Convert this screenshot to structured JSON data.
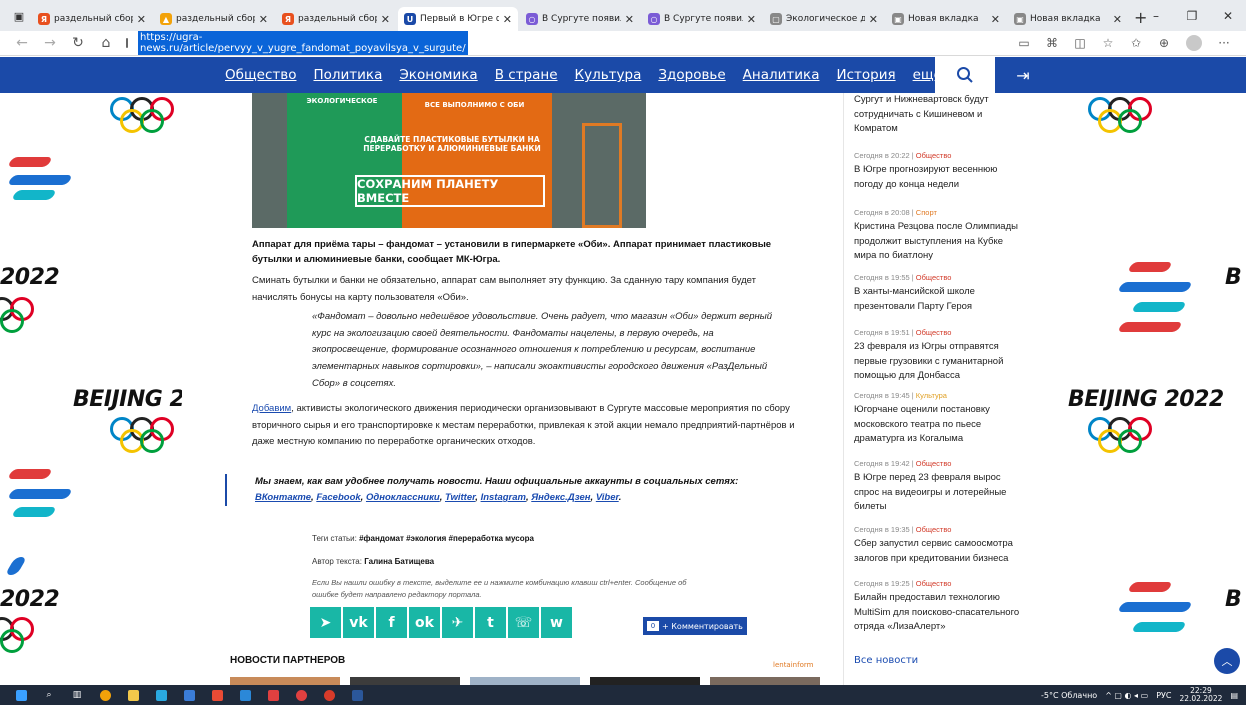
{
  "browser": {
    "tabs": [
      {
        "title": "раздельный сбор му",
        "favicon_color": "#e8501e",
        "favicon_glyph": "Я"
      },
      {
        "title": "раздельный сбор му",
        "favicon_color": "#f2a20a",
        "favicon_glyph": "▲"
      },
      {
        "title": "раздельный сбор му",
        "favicon_color": "#e8501e",
        "favicon_glyph": "Я"
      },
      {
        "title": "Первый в Югре фанд",
        "favicon_color": "#1b4aa8",
        "favicon_glyph": "U",
        "active": true
      },
      {
        "title": "В Сургуте появился ф",
        "favicon_color": "#7b5cd6",
        "favicon_glyph": "○"
      },
      {
        "title": "В Сургуте появился ф",
        "favicon_color": "#7b5cd6",
        "favicon_glyph": "○"
      },
      {
        "title": "Экологическое движ",
        "favicon_color": "#888888",
        "favicon_glyph": "▢"
      },
      {
        "title": "Новая вкладка",
        "favicon_color": "#888888",
        "favicon_glyph": "▣"
      },
      {
        "title": "Новая вкладка",
        "favicon_color": "#888888",
        "favicon_glyph": "▣"
      }
    ],
    "url": "https://ugra-news.ru/article/pervyy_v_yugre_fandomat_poyavilsya_v_surgute/"
  },
  "nav": {
    "items": [
      "Общество",
      "Политика",
      "Экономика",
      "В стране",
      "Культура",
      "Здоровье",
      "Аналитика",
      "История",
      "еще"
    ]
  },
  "photo": {
    "left_text": "ЭКОЛОГИЧЕСКОЕ",
    "top_text": "ВСЕ ВЫПОЛНИМО С ОБИ",
    "slogan": "СДАВАЙТЕ ПЛАСТИКОВЫЕ БУТЫЛКИ НА ПЕРЕРАБОТКУ И АЛЮМИНИЕВЫЕ БАНКИ",
    "banner": "СОХРАНИМ ПЛАНЕТУ ВМЕСТЕ"
  },
  "article": {
    "caption": "Аппарат для приёма тары – фандомат – установили в гипермаркете «Оби». Аппарат принимает пластиковые бутылки и алюминиевые банки, сообщает МК-Югра.",
    "para1": "Сминать бутылки и банки не обязательно, аппарат сам выполняет эту функцию. За сданную тару компания будет начислять бонусы на карту пользователя «Оби».",
    "quote": "«Фандомат – довольно недешёвое удовольствие. Очень радует, что магазин «Оби» держит верный курс на экологизацию своей деятельности. Фандоматы нацелены, в первую очередь, на экопросвещение, формирование осознанного отношения к потреблению и ресурсам, воспитание элементарных навыков сортировки», – написали экоактивисты городского движения «РазДельный Сбор» в соцсетях.",
    "para2_link": "Добавим",
    "para2": ", активисты экологического движения периодически организовывают в Сургуте массовые мероприятия по сбору вторичного сырья и его транспортировке к местам переработки, привлекая к этой акции немало предприятий-партнёров и даже местную компанию по переработке органических отходов.",
    "social_text": "Мы знаем, как вам удобнее получать новости. Наши официальные аккаунты в социальных сетях:",
    "social_links": [
      "ВКонтакте",
      "Facebook",
      "Одноклассники",
      "Twitter",
      "Instagram",
      "Яндекс.Дзен",
      "Viber"
    ],
    "tags_label": "Теги статьи:",
    "tags": "#фандомат #экология #переработка мусора",
    "author_label": "Автор текста:",
    "author": "Галина Батищева",
    "error_note": "Если Вы нашли ошибку в тексте, выделите ее и нажмите комбинацию клавиш ctrl+enter. Сообщение об ошибке будет направлено редактору портала.",
    "comments_count": "0",
    "comment_label": "+ Комментировать",
    "partners_title": "НОВОСТИ ПАРТНЕРОВ",
    "partners_brand": "lentainform"
  },
  "share": [
    "➤",
    "vk",
    "f",
    "ok",
    "✈",
    "t",
    "☏",
    "w"
  ],
  "sidebar": {
    "news": [
      {
        "time": "",
        "category": "",
        "cat_class": "",
        "headline": "Сургут и Нижневартовск будут сотрудничать с Кишиневом и Комратом"
      },
      {
        "time": "Сегодня в 20:22",
        "category": "Общество",
        "cat_class": "",
        "headline": "В Югре прогнозируют весеннюю погоду до конца недели"
      },
      {
        "time": "Сегодня в 20:08",
        "category": "Спорт",
        "cat_class": "sport",
        "headline": "Кристина Резцова после Олимпиады продолжит выступления на Кубке мира по биатлону"
      },
      {
        "time": "Сегодня в 19:55",
        "category": "Общество",
        "cat_class": "",
        "headline": "В ханты-мансийской школе презентовали Парту Героя"
      },
      {
        "time": "Сегодня в 19:51",
        "category": "Общество",
        "cat_class": "",
        "headline": "23 февраля из Югры отправятся первые грузовики с гуманитарной помощью для Донбасса"
      },
      {
        "time": "Сегодня в 19:45",
        "category": "Культура",
        "cat_class": "culture",
        "headline": "Югорчане оценили постановку московского театра по пьесе драматурга из Когалыма"
      },
      {
        "time": "Сегодня в 19:42",
        "category": "Общество",
        "cat_class": "",
        "headline": "В Югре перед 23 февраля вырос спрос на видеоигры и лотерейные билеты"
      },
      {
        "time": "Сегодня в 19:35",
        "category": "Общество",
        "cat_class": "",
        "headline": "Сбер запустил сервис самоосмотра залогов при кредитовании бизнеса"
      },
      {
        "time": "Сегодня в 19:25",
        "category": "Общество",
        "cat_class": "",
        "headline": "Билайн предоставил технологию MultiSim для поисково-спасательного отряда «ЛизаАлерт»"
      }
    ],
    "all_news": "Все новости"
  },
  "background": {
    "olympic_text": "BEIJING 2022",
    "year_text": "2022"
  },
  "taskbar": {
    "weather": "-5°C Облачно",
    "lang": "РУС",
    "time": "22:29",
    "date": "22.02.2022"
  }
}
